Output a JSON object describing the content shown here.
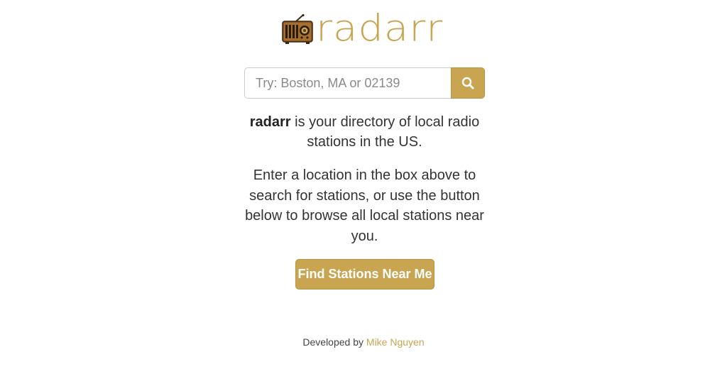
{
  "brand": {
    "name": "radarr",
    "logo_icon": "radio-icon",
    "accent_color": "#c9a451"
  },
  "search": {
    "placeholder": "Try: Boston, MA or 02139",
    "value": "",
    "button_icon": "search-icon"
  },
  "intro": {
    "brand_name": "radarr",
    "text": " is your directory of local radio stations in the US."
  },
  "instructions": {
    "text": "Enter a location in the box above to search for stations, or use the button below to browse all local stations near you."
  },
  "find_button": {
    "label": "Find Stations Near Me"
  },
  "footer": {
    "prefix": "Developed by ",
    "author": "Mike Nguyen"
  }
}
